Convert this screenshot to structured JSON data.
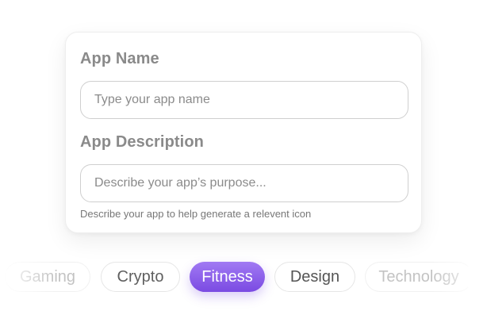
{
  "form": {
    "app_name_label": "App Name",
    "app_name_placeholder": "Type your app name",
    "app_name_value": "",
    "app_description_label": "App Description",
    "app_description_placeholder": "Describe your app’s purpose...",
    "app_description_value": "",
    "helper_text": "Describe your app to help generate a relevent icon"
  },
  "categories": {
    "items": [
      {
        "label": "Gaming",
        "state": "faded"
      },
      {
        "label": "Crypto",
        "state": "normal"
      },
      {
        "label": "Fitness",
        "state": "selected"
      },
      {
        "label": "Design",
        "state": "normal"
      },
      {
        "label": "Technology",
        "state": "faded"
      }
    ],
    "selected_label": "Fitness"
  },
  "colors": {
    "accent": "#8b5cf6",
    "accent_dark": "#7b4ae2",
    "label_text": "#8a8a8a",
    "border": "#cfcfcf"
  }
}
